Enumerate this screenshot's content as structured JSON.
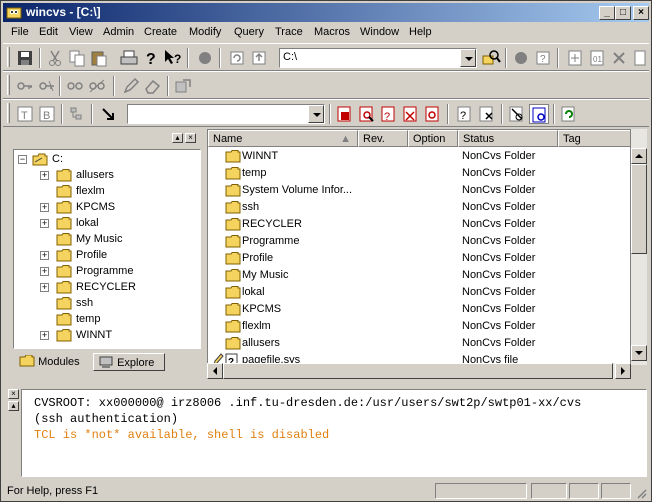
{
  "window": {
    "title": "wincvs - [C:\\]"
  },
  "menu": [
    "File",
    "Edit",
    "View",
    "Admin",
    "Create",
    "Modify",
    "Query",
    "Trace",
    "Macros",
    "Window",
    "Help"
  ],
  "toolbar": {
    "path_value": "C:\\",
    "filter_value": ""
  },
  "tree": {
    "root": "C:",
    "items": [
      {
        "label": "allusers",
        "expandable": true
      },
      {
        "label": "flexlm",
        "expandable": false
      },
      {
        "label": "KPCMS",
        "expandable": true
      },
      {
        "label": "lokal",
        "expandable": true
      },
      {
        "label": "My Music",
        "expandable": false
      },
      {
        "label": "Profile",
        "expandable": true
      },
      {
        "label": "Programme",
        "expandable": true
      },
      {
        "label": "RECYCLER",
        "expandable": true
      },
      {
        "label": "ssh",
        "expandable": false
      },
      {
        "label": "temp",
        "expandable": false
      },
      {
        "label": "WINNT",
        "expandable": true
      }
    ]
  },
  "tabs": {
    "modules": "Modules",
    "explore": "Explore"
  },
  "list": {
    "columns": [
      "Name",
      "Rev.",
      "Option",
      "Status",
      "Tag"
    ],
    "rows": [
      {
        "name": "WINNT",
        "status": "NonCvs Folder"
      },
      {
        "name": "temp",
        "status": "NonCvs Folder"
      },
      {
        "name": "System Volume Infor...",
        "status": "NonCvs Folder"
      },
      {
        "name": "ssh",
        "status": "NonCvs Folder"
      },
      {
        "name": "RECYCLER",
        "status": "NonCvs Folder"
      },
      {
        "name": "Programme",
        "status": "NonCvs Folder"
      },
      {
        "name": "Profile",
        "status": "NonCvs Folder"
      },
      {
        "name": "My Music",
        "status": "NonCvs Folder"
      },
      {
        "name": "lokal",
        "status": "NonCvs Folder"
      },
      {
        "name": "KPCMS",
        "status": "NonCvs Folder"
      },
      {
        "name": "flexlm",
        "status": "NonCvs Folder"
      },
      {
        "name": "allusers",
        "status": "NonCvs Folder"
      }
    ],
    "partial_row": {
      "name": "pagefile.sys",
      "status": "NonCvs file"
    }
  },
  "console": {
    "line1": "CVSROOT: xx000000@ irz8006 .inf.tu-dresden.de:/usr/users/swt2p/swtp01-xx/cvs",
    "line2": "(ssh authentication)",
    "line3": "TCL is *not* available, shell is disabled"
  },
  "status": {
    "text": "For Help, press F1"
  },
  "colors": {
    "title_start": "#0a246a",
    "title_end": "#a6caf0",
    "folder": "#f4d35e",
    "warning_text": "#e08010"
  }
}
